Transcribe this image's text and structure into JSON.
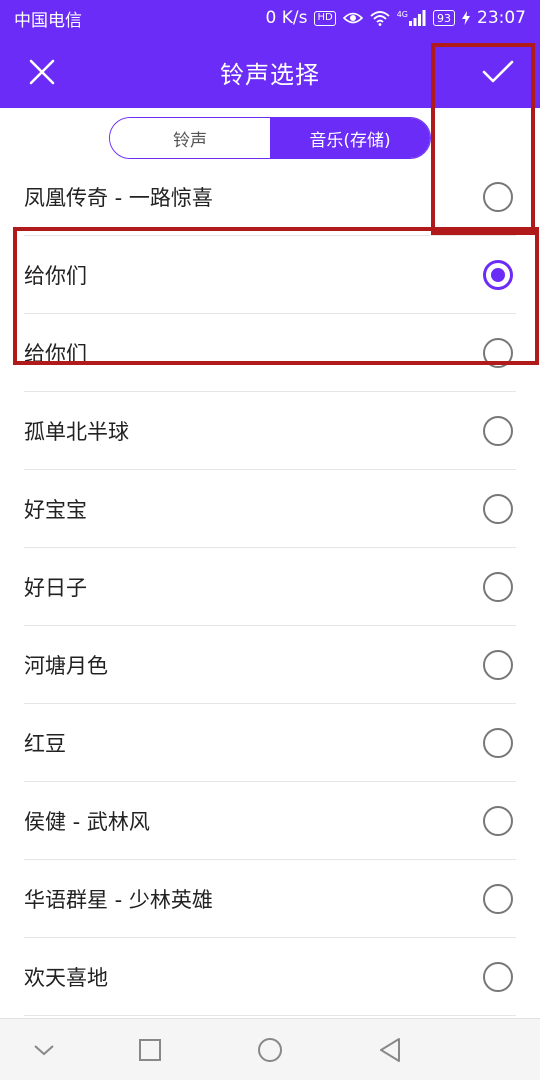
{
  "status_bar": {
    "carrier": "中国电信",
    "speed": "0 K/s",
    "hd_badge": "HD",
    "network": "4G",
    "battery": "93",
    "time": "23:07"
  },
  "app_bar": {
    "title": "铃声选择",
    "close_icon": "close-icon",
    "confirm_icon": "check-icon"
  },
  "tabs": [
    {
      "label": "铃声",
      "selected": false
    },
    {
      "label": "音乐(存储)",
      "selected": true
    }
  ],
  "songs": [
    {
      "title": "凤凰传奇 - 一路惊喜",
      "selected": false
    },
    {
      "title": "给你们",
      "selected": true
    },
    {
      "title": "给你们",
      "selected": false
    },
    {
      "title": "孤单北半球",
      "selected": false
    },
    {
      "title": "好宝宝",
      "selected": false
    },
    {
      "title": "好日子",
      "selected": false
    },
    {
      "title": "河塘月色",
      "selected": false
    },
    {
      "title": "红豆",
      "selected": false
    },
    {
      "title": "侯健 - 武林风",
      "selected": false
    },
    {
      "title": "华语群星 - 少林英雄",
      "selected": false
    },
    {
      "title": "欢天喜地",
      "selected": false
    }
  ],
  "colors": {
    "accent": "#6a2cf6",
    "highlight": "#b01a1a"
  },
  "nav_bar": [
    "collapse-icon",
    "recents-icon",
    "home-icon",
    "back-icon"
  ]
}
